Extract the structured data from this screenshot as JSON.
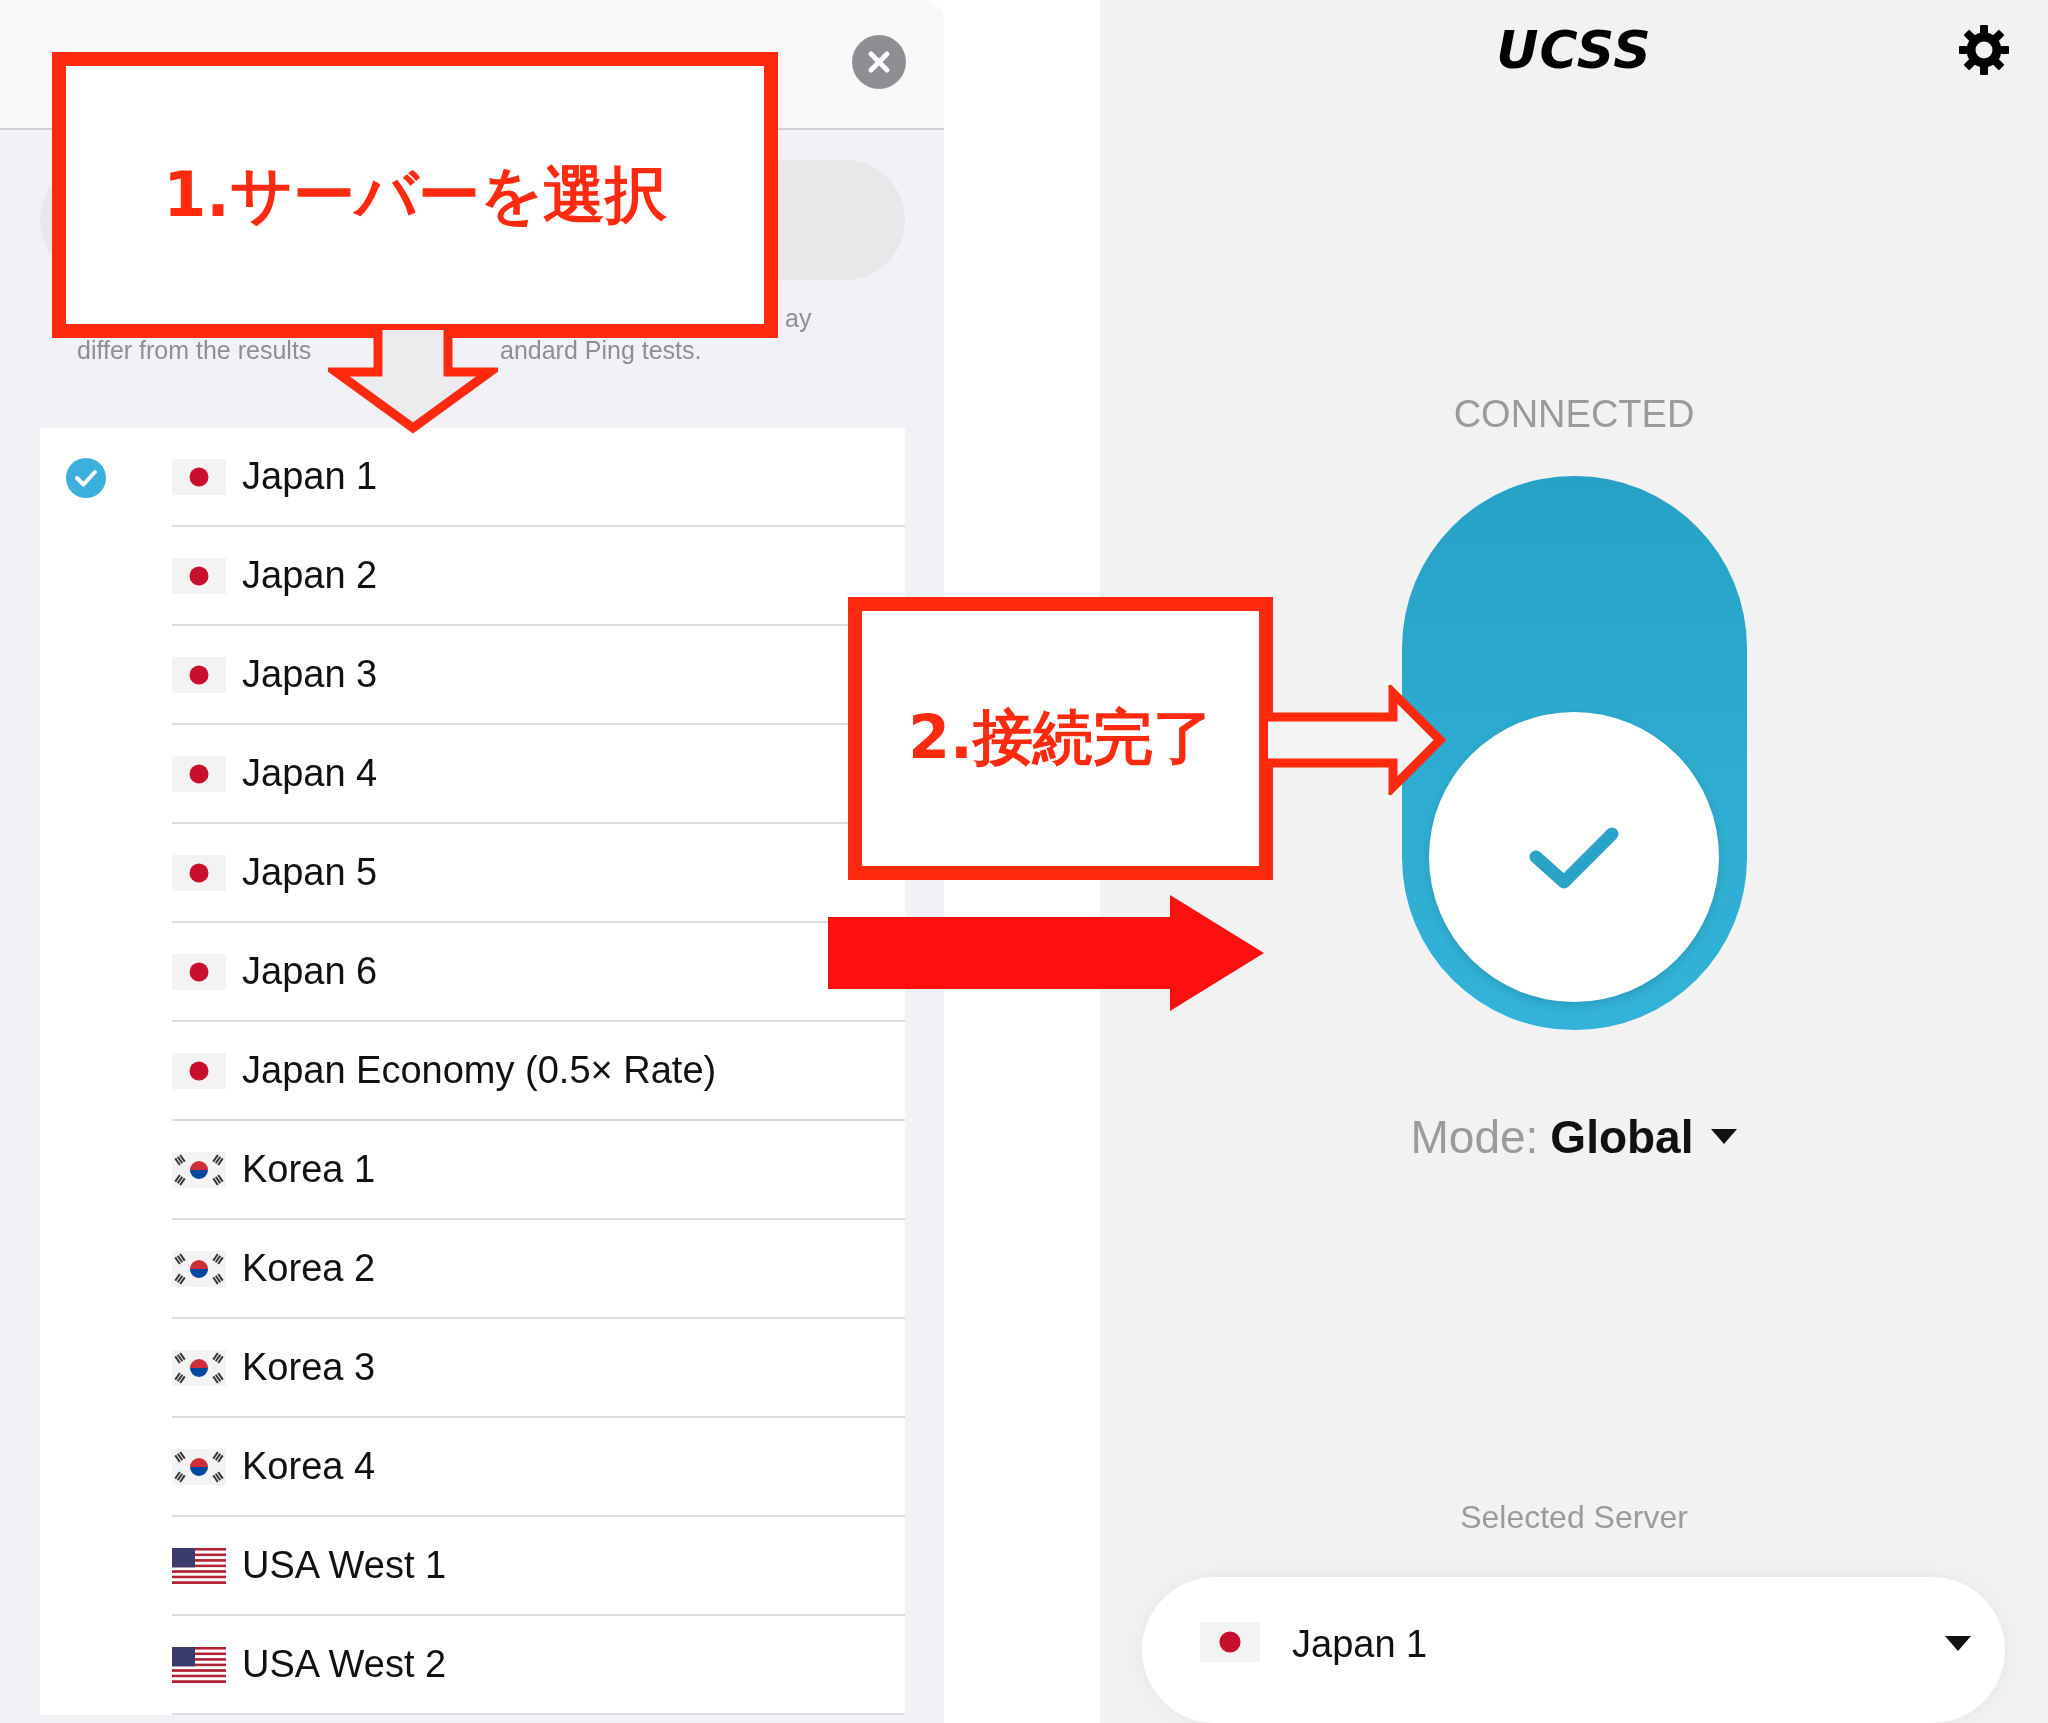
{
  "server_list": {
    "note": [
      "ay",
      "differ from the results",
      "andard Ping tests."
    ],
    "servers": [
      {
        "name": "Japan 1",
        "kind": "jp",
        "selected": true
      },
      {
        "name": "Japan 2",
        "kind": "jp",
        "selected": false
      },
      {
        "name": "Japan 3",
        "kind": "jp",
        "selected": false
      },
      {
        "name": "Japan 4",
        "kind": "jp",
        "selected": false
      },
      {
        "name": "Japan 5",
        "kind": "jp",
        "selected": false
      },
      {
        "name": "Japan 6",
        "kind": "jp",
        "selected": false
      },
      {
        "name": "Japan Economy (0.5× Rate)",
        "kind": "jp",
        "selected": false
      },
      {
        "name": "Korea 1",
        "kind": "kr",
        "selected": false
      },
      {
        "name": "Korea 2",
        "kind": "kr",
        "selected": false
      },
      {
        "name": "Korea 3",
        "kind": "kr",
        "selected": false
      },
      {
        "name": "Korea 4",
        "kind": "kr",
        "selected": false
      },
      {
        "name": "USA West 1",
        "kind": "us",
        "selected": false
      },
      {
        "name": "USA West 2",
        "kind": "us",
        "selected": false
      }
    ]
  },
  "main": {
    "logo": "UCSS",
    "status": "CONNECTED",
    "connected": true,
    "mode_label": "Mode:",
    "mode_value": "Global",
    "selected_server_label": "Selected Server",
    "selected_server": {
      "name": "Japan 1",
      "kind": "jp"
    }
  },
  "annotations": [
    {
      "text": "1.サーバーを選択"
    },
    {
      "text": "2.接続完了"
    }
  ]
}
